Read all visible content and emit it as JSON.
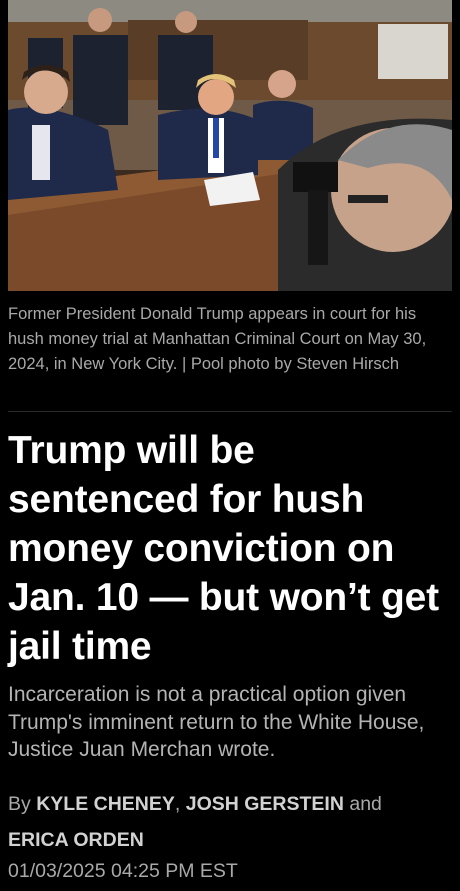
{
  "photo": {
    "alt": "Courtroom photo"
  },
  "caption": {
    "text": "Former President Donald Trump appears in court for his hush money trial at Manhattan Criminal Court on May 30, 2024, in New York City. | Pool photo by Steven Hirsch"
  },
  "article": {
    "headline": "Trump will be sentenced for hush money conviction on Jan. 10 — but won’t get jail time",
    "dek": "Incarceration is not a practical option given Trump's imminent return to the White House, Justice Juan Merchan wrote.",
    "byline": {
      "prefix": "By",
      "authors": [
        "KYLE CHENEY",
        "JOSH GERSTEIN",
        "ERICA ORDEN"
      ],
      "separator": ",",
      "conjunction": "and"
    },
    "timestamp": "01/03/2025 04:25 PM EST"
  }
}
